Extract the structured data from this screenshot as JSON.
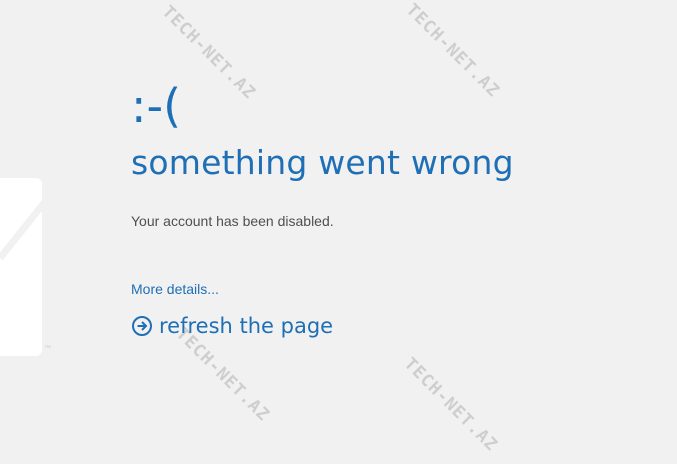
{
  "error": {
    "face": ":-(",
    "headline": "something went wrong",
    "message": "Your account has been disabled.",
    "details_link": "More details...",
    "refresh_label": "refresh the page",
    "refresh_icon": "arrow-circle-right-icon"
  },
  "background": {
    "trademark": "™",
    "watermark_text": "TECH-NET.AZ"
  },
  "colors": {
    "accent": "#1e6fb5",
    "text": "#4f4f4f",
    "background": "#f1f1f1",
    "watermark": "#c9c9c9"
  }
}
